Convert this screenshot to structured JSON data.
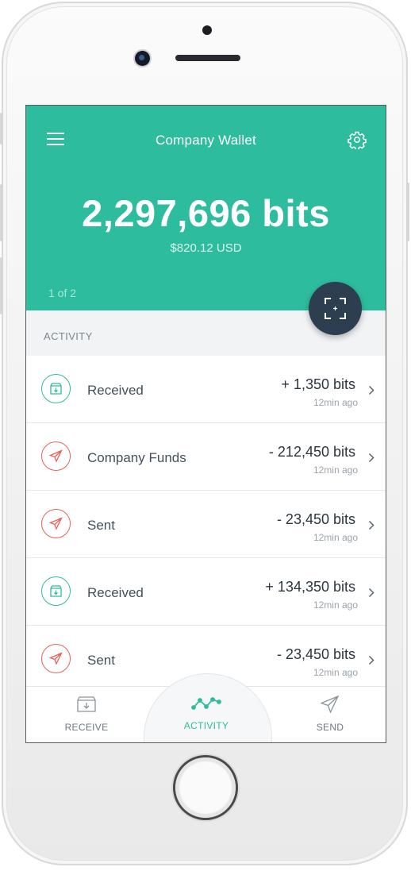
{
  "header": {
    "title": "Company Wallet",
    "balance": "2,297,696 bits",
    "balance_usd": "$820.12 USD",
    "pager": "1 of 2"
  },
  "activity": {
    "section_label": "ACTIVITY",
    "items": [
      {
        "type": "received",
        "label": "Received",
        "amount": "+ 1,350 bits",
        "time": "12min ago"
      },
      {
        "type": "sent",
        "label": "Company Funds",
        "amount": "- 212,450 bits",
        "time": "12min ago"
      },
      {
        "type": "sent",
        "label": "Sent",
        "amount": "- 23,450 bits",
        "time": "12min ago"
      },
      {
        "type": "received",
        "label": "Received",
        "amount": "+ 134,350 bits",
        "time": "12min ago"
      },
      {
        "type": "sent",
        "label": "Sent",
        "amount": "- 23,450 bits",
        "time": "12min ago"
      }
    ]
  },
  "tabbar": {
    "receive": "RECEIVE",
    "activity": "ACTIVITY",
    "send": "SEND"
  },
  "colors": {
    "accent": "#2dbd9e",
    "sent": "#e8625a",
    "dark": "#2c3e50"
  },
  "icons": [
    "menu-icon",
    "gear-icon",
    "scan-icon",
    "receive-icon",
    "send-icon",
    "activity-icon",
    "chevron-right-icon"
  ]
}
